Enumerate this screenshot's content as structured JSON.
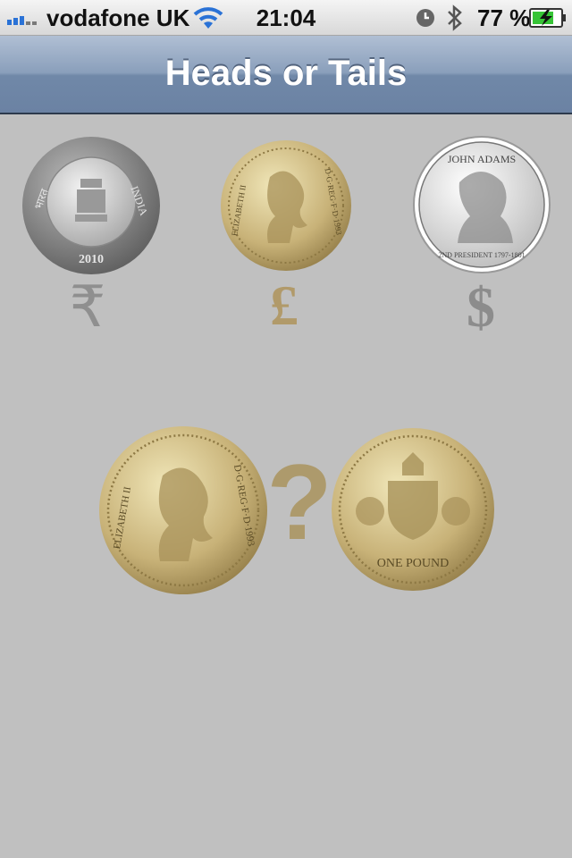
{
  "status_bar": {
    "carrier": "vodafone UK",
    "time": "21:04",
    "battery_percent": "77 %",
    "signal_bars": 3,
    "signal_total": 5
  },
  "nav": {
    "title": "Heads or Tails"
  },
  "currencies": [
    {
      "name": "rupee",
      "symbol": "₹",
      "coin_top_text": "INDIA",
      "coin_left_text": "भारत",
      "coin_year": "2010"
    },
    {
      "name": "pound",
      "symbol": "£",
      "coin_left_text": "ELIZABETH II",
      "coin_right_text": "D·G·REG·F·D·1993"
    },
    {
      "name": "dollar",
      "symbol": "$",
      "coin_top_text": "JOHN ADAMS",
      "coin_bottom_text": "2ND PRESIDENT 1797-1801"
    }
  ],
  "result": {
    "symbol": "?",
    "heads_left_text": "ELIZABETH II",
    "heads_right_text": "D·G·REG·F·D·1993",
    "tails_bottom_text": "ONE POUND"
  },
  "colors": {
    "background": "#c0c0c0",
    "nav_blue": "#6b82a3",
    "gold": "#b19a6a",
    "silver": "#8f8f8f"
  }
}
